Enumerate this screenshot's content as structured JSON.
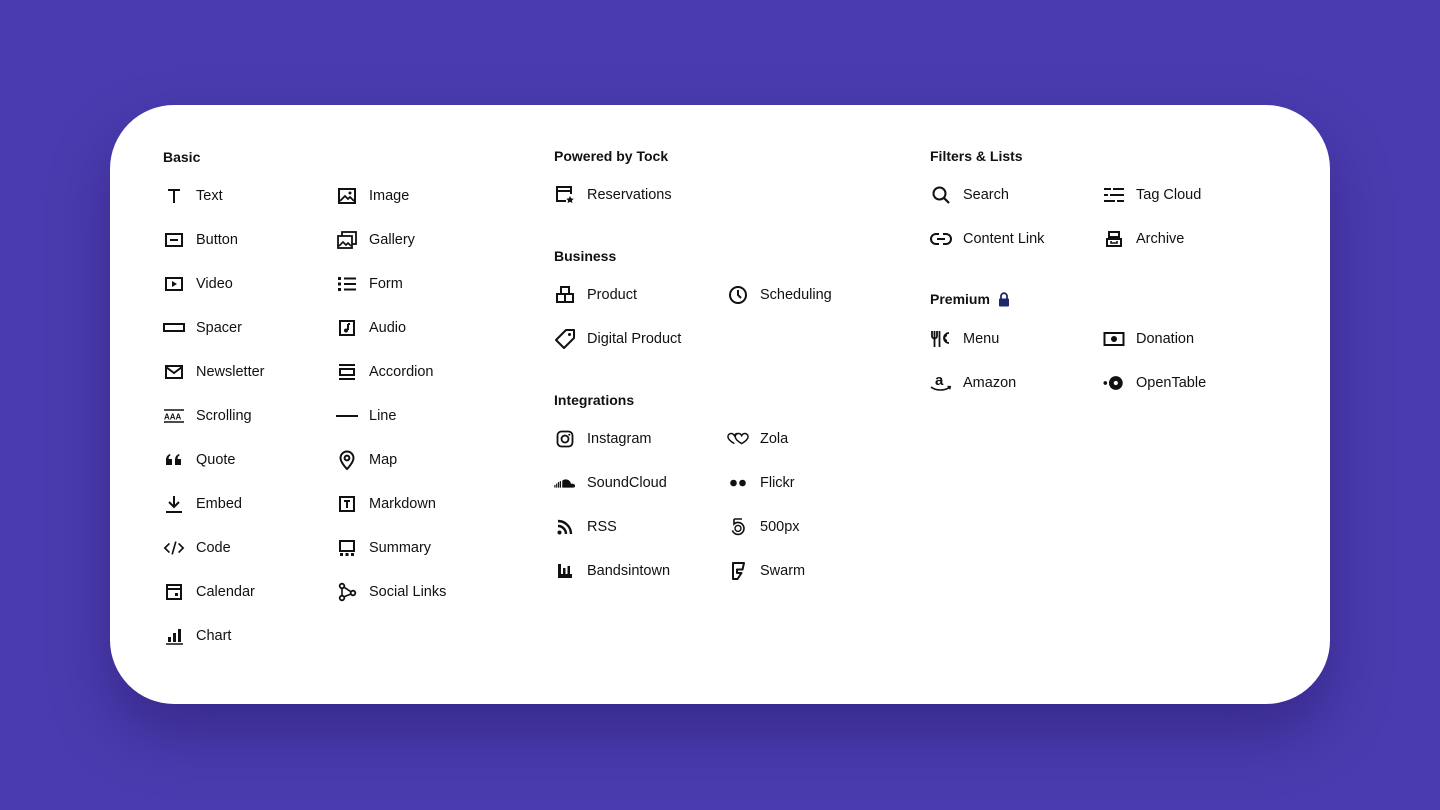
{
  "basic": {
    "title": "Basic",
    "col1": [
      {
        "label": "Text",
        "icon": "text-icon"
      },
      {
        "label": "Button",
        "icon": "button-icon"
      },
      {
        "label": "Video",
        "icon": "video-icon"
      },
      {
        "label": "Spacer",
        "icon": "spacer-icon"
      },
      {
        "label": "Newsletter",
        "icon": "newsletter-icon"
      },
      {
        "label": "Scrolling",
        "icon": "scrolling-icon"
      },
      {
        "label": "Quote",
        "icon": "quote-icon"
      },
      {
        "label": "Embed",
        "icon": "embed-icon"
      },
      {
        "label": "Code",
        "icon": "code-icon"
      },
      {
        "label": "Calendar",
        "icon": "calendar-icon"
      },
      {
        "label": "Chart",
        "icon": "chart-icon"
      }
    ],
    "col2": [
      {
        "label": "Image",
        "icon": "image-icon"
      },
      {
        "label": "Gallery",
        "icon": "gallery-icon"
      },
      {
        "label": "Form",
        "icon": "form-icon"
      },
      {
        "label": "Audio",
        "icon": "audio-icon"
      },
      {
        "label": "Accordion",
        "icon": "accordion-icon"
      },
      {
        "label": "Line",
        "icon": "line-icon"
      },
      {
        "label": "Map",
        "icon": "map-pin-icon"
      },
      {
        "label": "Markdown",
        "icon": "markdown-icon"
      },
      {
        "label": "Summary",
        "icon": "summary-icon"
      },
      {
        "label": "Social Links",
        "icon": "social-links-icon"
      }
    ]
  },
  "tock": {
    "title": "Powered by Tock",
    "items": [
      {
        "label": "Reservations",
        "icon": "reservations-icon"
      }
    ]
  },
  "business": {
    "title": "Business",
    "items": [
      {
        "label": "Product",
        "icon": "product-icon"
      },
      {
        "label": "Scheduling",
        "icon": "clock-icon"
      },
      {
        "label": "Digital Product",
        "icon": "tag-icon"
      }
    ]
  },
  "integrations": {
    "title": "Integrations",
    "col1": [
      {
        "label": "Instagram",
        "icon": "instagram-icon"
      },
      {
        "label": "SoundCloud",
        "icon": "soundcloud-icon"
      },
      {
        "label": "RSS",
        "icon": "rss-icon"
      },
      {
        "label": "Bandsintown",
        "icon": "bandsintown-icon"
      }
    ],
    "col2": [
      {
        "label": "Zola",
        "icon": "zola-icon"
      },
      {
        "label": "Flickr",
        "icon": "flickr-icon"
      },
      {
        "label": "500px",
        "icon": "500px-icon"
      },
      {
        "label": "Swarm",
        "icon": "swarm-icon"
      }
    ]
  },
  "filters": {
    "title": "Filters & Lists",
    "items": [
      {
        "label": "Search",
        "icon": "search-icon"
      },
      {
        "label": "Tag Cloud",
        "icon": "tag-cloud-icon"
      },
      {
        "label": "Content Link",
        "icon": "link-icon"
      },
      {
        "label": "Archive",
        "icon": "archive-icon"
      }
    ]
  },
  "premium": {
    "title": "Premium",
    "lock_icon": "lock-icon",
    "lock_color": "#1c2a6b",
    "items": [
      {
        "label": "Menu",
        "icon": "menu-icon"
      },
      {
        "label": "Donation",
        "icon": "donation-icon"
      },
      {
        "label": "Amazon",
        "icon": "amazon-icon"
      },
      {
        "label": "OpenTable",
        "icon": "opentable-icon"
      }
    ]
  },
  "colors": {
    "background": "#4a3cb0",
    "panel": "#ffffff",
    "text": "#111111"
  }
}
